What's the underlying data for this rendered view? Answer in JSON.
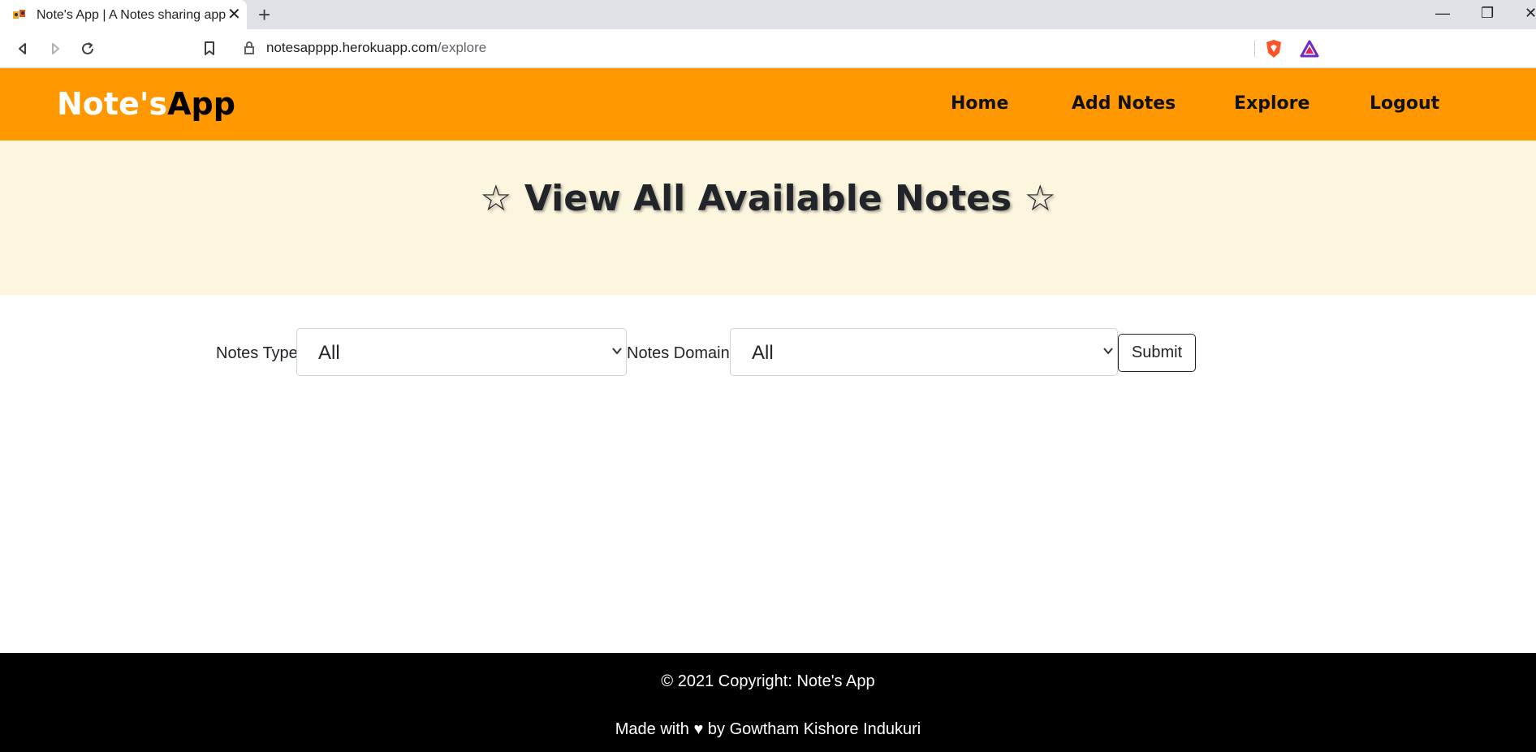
{
  "browser": {
    "tab_title": "Note's App | A Notes sharing app",
    "tab_close": "✕",
    "new_tab": "+",
    "url_host": "notesapppp.herokuapp.com",
    "url_path": "/explore",
    "window_controls": [
      "—",
      "❐",
      "✕"
    ]
  },
  "navbar": {
    "brand_part1": "Note's",
    "brand_part2": "App",
    "links": [
      "Home",
      "Add Notes",
      "Explore",
      "Logout"
    ],
    "bg_color": "#ff9800"
  },
  "hero": {
    "title": "☆ View All Available Notes ☆",
    "bg_color": "#fdf6df"
  },
  "filters": {
    "type_label": "Notes Type",
    "type_value": "All",
    "domain_label": "Notes Domain",
    "domain_value": "All",
    "submit_label": "Submit"
  },
  "footer": {
    "copyright": "© 2021 Copyright: Note's App",
    "credit": "Made with ♥ by Gowtham Kishore Indukuri"
  }
}
